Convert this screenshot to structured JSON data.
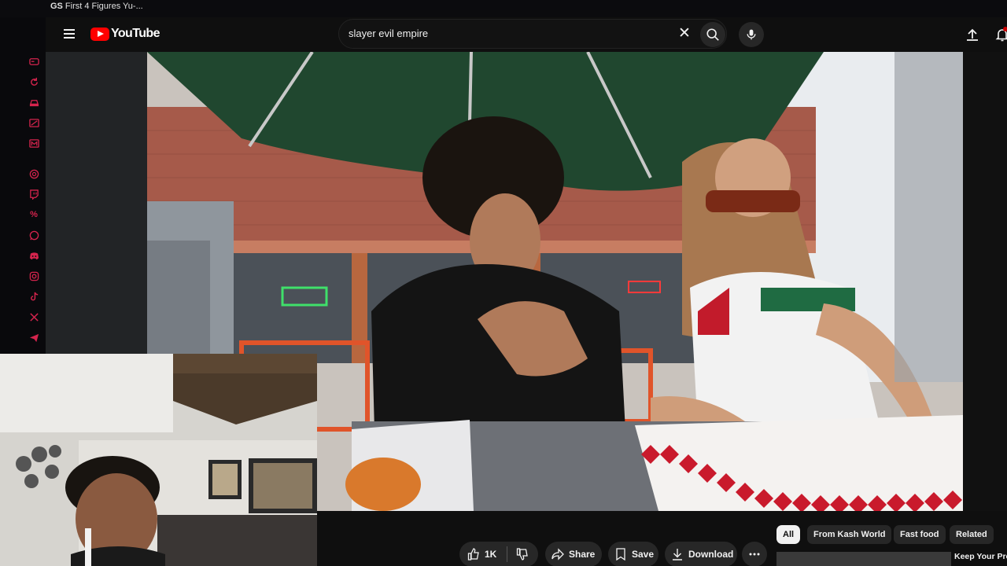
{
  "window": {
    "tab_icon_text": "GS",
    "tab_title": "First 4 Figures Yu-..."
  },
  "sidebar": {
    "accent_color": "#d4244d",
    "icons": [
      "gamepad-icon",
      "refresh-icon",
      "car-icon",
      "tag-icon",
      "mail-icon",
      "openai-icon",
      "twitch-icon",
      "percent-icon",
      "whatsapp-icon",
      "discord-icon",
      "instagram-icon",
      "tiktok-icon",
      "x-icon",
      "telegram-icon"
    ]
  },
  "header": {
    "logo_text": "YouTube",
    "search_value": "slayer evil empire",
    "brand_color": "#ff0000"
  },
  "actions": {
    "like_count": "1K",
    "share_label": "Share",
    "save_label": "Save",
    "download_label": "Download"
  },
  "chips": [
    {
      "label": "All",
      "active": true
    },
    {
      "label": "From Kash World",
      "active": false
    },
    {
      "label": "Fast food",
      "active": false
    },
    {
      "label": "Related",
      "active": false
    }
  ],
  "recommendation": {
    "title": "Keep Your Pro"
  }
}
